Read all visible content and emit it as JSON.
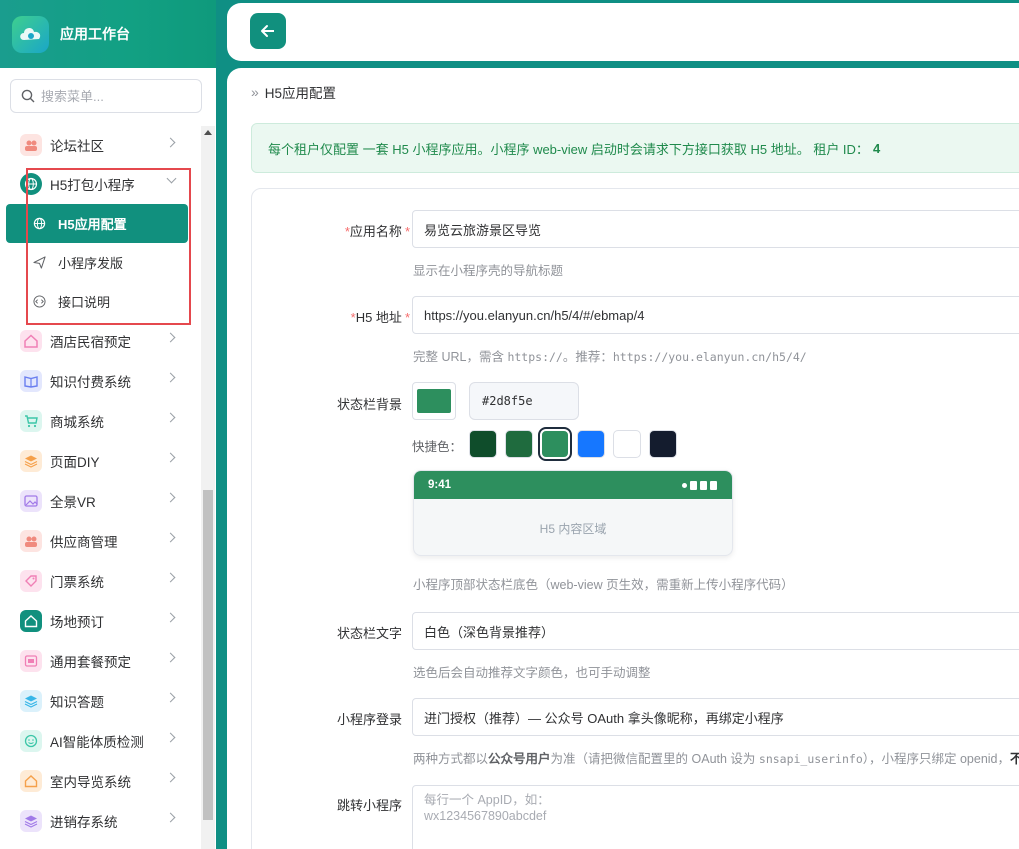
{
  "app": {
    "title": "应用工作台"
  },
  "search": {
    "placeholder": "搜索菜单..."
  },
  "menu": {
    "items_before": [
      {
        "label": "论坛社区",
        "icon": "community-icon",
        "color": "#f08a7e"
      }
    ],
    "group": {
      "label": "H5打包小程序",
      "icon": "globe-icon",
      "color": "#11907e",
      "children": [
        {
          "label": "H5应用配置",
          "icon": "globe-icon",
          "active": true
        },
        {
          "label": "小程序发版",
          "icon": "send-icon",
          "active": false
        },
        {
          "label": "接口说明",
          "icon": "code-icon",
          "active": false
        }
      ]
    },
    "items_after": [
      {
        "label": "酒店民宿预定",
        "icon": "hotel-icon",
        "color": "#f07fb5"
      },
      {
        "label": "知识付费系统",
        "icon": "book-icon",
        "color": "#6a7ef0"
      },
      {
        "label": "商城系统",
        "icon": "cart-icon",
        "color": "#3cc6a8"
      },
      {
        "label": "页面DIY",
        "icon": "layers-icon",
        "color": "#f5a04a"
      },
      {
        "label": "全景VR",
        "icon": "image-icon",
        "color": "#a17ae8"
      },
      {
        "label": "供应商管理",
        "icon": "users-icon",
        "color": "#f08a7e"
      },
      {
        "label": "门票系统",
        "icon": "ticket-icon",
        "color": "#f07fb5"
      },
      {
        "label": "场地预订",
        "icon": "home-icon",
        "color": "#11907e"
      },
      {
        "label": "通用套餐预定",
        "icon": "package-icon",
        "color": "#f07fb5"
      },
      {
        "label": "知识答题",
        "icon": "stack-icon",
        "color": "#37b6e8"
      },
      {
        "label": "AI智能体质检测",
        "icon": "smile-icon",
        "color": "#3cc6a8"
      },
      {
        "label": "室内导览系统",
        "icon": "house-icon",
        "color": "#f5a04a"
      },
      {
        "label": "进销存系统",
        "icon": "stack-icon",
        "color": "#a17ae8"
      }
    ]
  },
  "breadcrumb": {
    "current": "H5应用配置"
  },
  "notice": {
    "text": "每个租户仅配置 一套 H5 小程序应用。小程序 web-view 启动时会请求下方接口获取 H5 地址。 租户 ID：",
    "tenant_id": "4"
  },
  "form": {
    "app_name": {
      "label": "应用名称",
      "value": "易览云旅游景区导览",
      "hint": "显示在小程序壳的导航标题"
    },
    "h5_url": {
      "label": "H5 地址",
      "value": "https://you.elanyun.cn/h5/4/#/ebmap/4",
      "hint_prefix": "完整 URL，需含 ",
      "hint_code": "https://",
      "hint_mid": "。推荐：",
      "hint_example": "https://you.elanyun.cn/h5/4/"
    },
    "statusbar_bg": {
      "label": "状态栏背景",
      "value": "#2d8f5e",
      "quick_label": "快捷色：",
      "quick_colors": [
        "#0f4d2b",
        "#1f6b3e",
        "#2d8f5e",
        "#1677ff",
        "#ffffff",
        "#141c2e"
      ],
      "preview_time": "9:41",
      "preview_body": "H5 内容区域",
      "hint": "小程序顶部状态栏底色（web-view 页生效，需重新上传小程序代码）"
    },
    "statusbar_text": {
      "label": "状态栏文字",
      "value": "白色（深色背景推荐）",
      "hint": "选色后会自动推荐文字颜色，也可手动调整"
    },
    "login": {
      "label": "小程序登录",
      "value": "进门授权（推荐）— 公众号 OAuth 拿头像昵称，再绑定小程序",
      "hint_prefix": "两种方式都以",
      "hint_bold": "公众号用户",
      "hint_mid": "为准（请把微信配置里的 OAuth 设为 ",
      "hint_code": "snsapi_userinfo",
      "hint_after": "），小程序只绑定 openid，",
      "hint_bold2": "不会单独"
    },
    "jump": {
      "label": "跳转小程序",
      "placeholder_line1": "每行一个 AppID，如：",
      "placeholder_line2": "wx1234567890abcdef"
    }
  }
}
